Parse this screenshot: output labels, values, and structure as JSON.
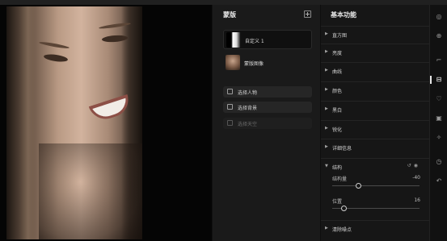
{
  "mask_panel": {
    "title": "蒙版",
    "masks": [
      {
        "label": "自定义 1",
        "selected": true
      },
      {
        "label": "蒙版图像",
        "selected": false
      }
    ],
    "add_buttons": [
      {
        "label": "选择人物",
        "enabled": true
      },
      {
        "label": "选择背景",
        "enabled": true
      },
      {
        "label": "选择天空",
        "enabled": false
      }
    ]
  },
  "adjust_panel": {
    "title": "基本功能",
    "sections": [
      {
        "label": "直方图",
        "expanded": false
      },
      {
        "label": "亮度",
        "expanded": false
      },
      {
        "label": "曲线",
        "expanded": false
      },
      {
        "label": "颜色",
        "expanded": false
      },
      {
        "label": "黑白",
        "expanded": false
      },
      {
        "label": "锐化",
        "expanded": false
      },
      {
        "label": "详细信息",
        "expanded": false
      },
      {
        "label": "结构",
        "expanded": true
      }
    ],
    "structure_sliders": [
      {
        "name": "结构量",
        "value": "-40",
        "fraction": 0.3
      },
      {
        "name": "位置",
        "value": "16",
        "fraction": 0.13
      }
    ],
    "bottom_section": {
      "label": "清除噪点",
      "expanded": false
    }
  },
  "toolbar": {
    "tools": [
      {
        "icon": "palette-icon",
        "glyph": "◎",
        "active": false
      },
      {
        "icon": "adjust-icon",
        "glyph": "⊕",
        "active": false
      },
      {
        "icon": "crop-icon",
        "glyph": "⌐",
        "active": false
      },
      {
        "icon": "sliders-icon",
        "glyph": "⊟",
        "active": true
      },
      {
        "icon": "heal-icon",
        "glyph": "♡",
        "active": false
      },
      {
        "icon": "mask-icon",
        "glyph": "▣",
        "active": false
      },
      {
        "icon": "star-icon",
        "glyph": "✧",
        "active": false
      },
      {
        "icon": "history-icon",
        "glyph": "◷",
        "active": false
      },
      {
        "icon": "undo-icon",
        "glyph": "↶",
        "active": false
      }
    ]
  },
  "colors": {
    "panel_bg": "#1a1a1a",
    "adjust_bg": "#161616",
    "accent": "#e6e6e6"
  }
}
